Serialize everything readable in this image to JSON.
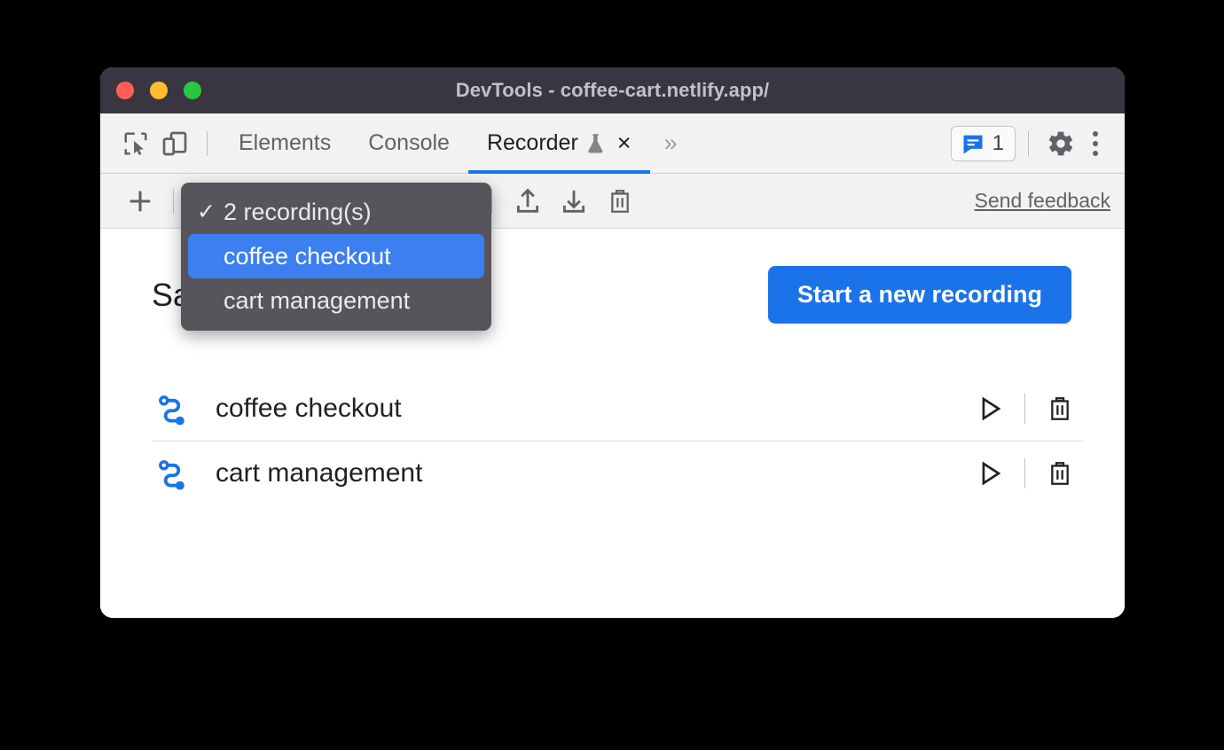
{
  "window": {
    "title": "DevTools - coffee-cart.netlify.app/",
    "traffic_lights": [
      "close",
      "minimize",
      "maximize"
    ],
    "colors": {
      "titlebar_bg": "#3a3641",
      "title_text": "#c3c0c7",
      "red": "#ff5f57",
      "yellow": "#febc2e",
      "green": "#28c840",
      "accent_blue": "#1a73e8",
      "menu_bg": "#57545b",
      "menu_selected": "#3b7ff0",
      "flow_icon_blue": "#1a73e8"
    }
  },
  "tabbar": {
    "left_icons": [
      {
        "name": "inspect-element-icon",
        "label": "Inspect element"
      },
      {
        "name": "device-toolbar-icon",
        "label": "Toggle device toolbar"
      }
    ],
    "tabs": [
      {
        "label": "Elements",
        "active": false
      },
      {
        "label": "Console",
        "active": false
      },
      {
        "label": "Recorder",
        "active": true,
        "experimental": true
      }
    ],
    "tab_close_glyph": "×",
    "overflow_glyph": "»",
    "issues_count": "1",
    "settings_icon": "gear-icon",
    "more_options_icon": "kebab-menu-icon"
  },
  "recorder_toolbar": {
    "add_label": "+",
    "select_value": "2 recording(s)",
    "export_icon": "export-icon",
    "import_icon": "import-icon",
    "delete_icon": "trash-icon",
    "send_feedback": "Send feedback"
  },
  "dropdown": {
    "items": [
      {
        "label": "2 recording(s)",
        "checked": true,
        "selected": false
      },
      {
        "label": "coffee checkout",
        "checked": false,
        "selected": true
      },
      {
        "label": "cart management",
        "checked": false,
        "selected": false
      }
    ],
    "check_glyph": "✓"
  },
  "panel": {
    "title": "Saved recordings",
    "start_button": "Start a new recording",
    "recordings": [
      {
        "name": "coffee checkout",
        "icon": "user-flow-icon"
      },
      {
        "name": "cart management",
        "icon": "user-flow-icon"
      }
    ],
    "row_actions": {
      "play": "Replay recording",
      "delete": "Delete recording"
    }
  }
}
